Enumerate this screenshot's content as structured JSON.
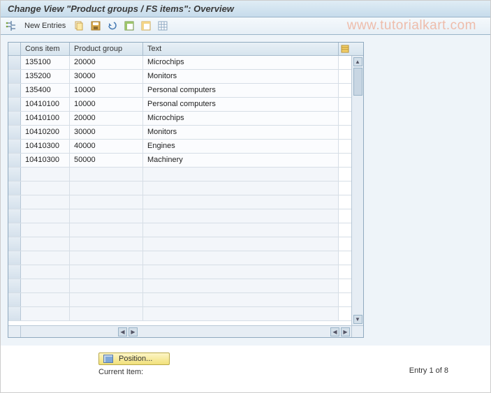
{
  "header": {
    "title": "Change View \"Product groups / FS items\": Overview"
  },
  "toolbar": {
    "new_entries_label": "New Entries"
  },
  "watermark": "www.tutorialkart.com",
  "table": {
    "columns": {
      "cons": "Cons item",
      "prod": "Product group",
      "text": "Text"
    },
    "rows": [
      {
        "cons": "135100",
        "prod": "20000",
        "text": "Microchips"
      },
      {
        "cons": "135200",
        "prod": "30000",
        "text": "Monitors"
      },
      {
        "cons": "135400",
        "prod": "10000",
        "text": "Personal computers"
      },
      {
        "cons": "10410100",
        "prod": "10000",
        "text": "Personal computers"
      },
      {
        "cons": "10410100",
        "prod": "20000",
        "text": "Microchips"
      },
      {
        "cons": "10410200",
        "prod": "30000",
        "text": "Monitors"
      },
      {
        "cons": "10410300",
        "prod": "40000",
        "text": "Engines"
      },
      {
        "cons": "10410300",
        "prod": "50000",
        "text": "Machinery"
      }
    ],
    "empty_rows": 11
  },
  "footer": {
    "position_label": "Position...",
    "current_item_label": "Current Item:",
    "entry_count": "Entry 1 of 8"
  }
}
